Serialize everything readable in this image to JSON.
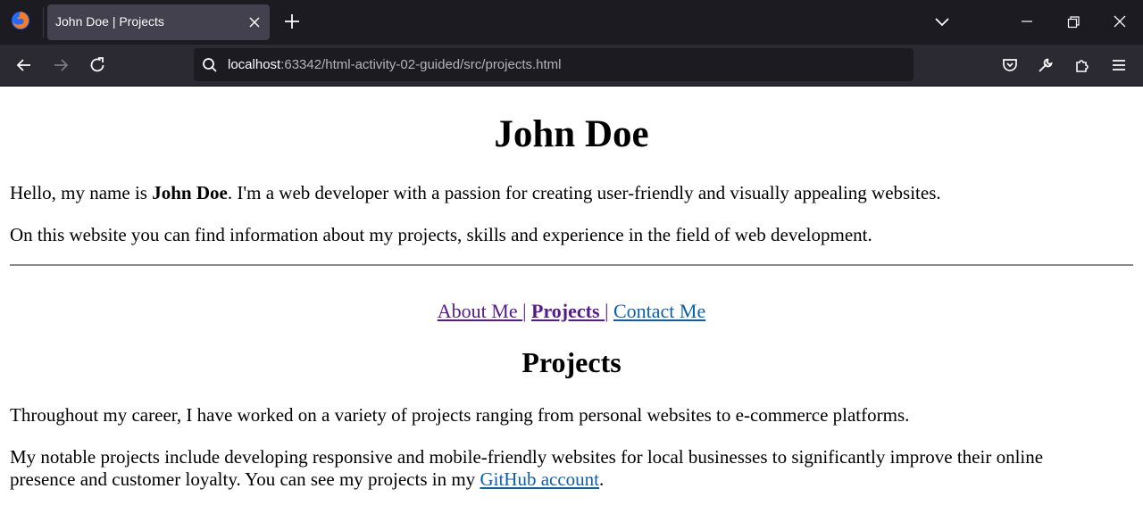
{
  "browser": {
    "tab_title": "John Doe | Projects",
    "url_host": "localhost",
    "url_path": ":63342/html-activity-02-guided/src/projects.html"
  },
  "page": {
    "heading": "John Doe",
    "intro": {
      "before": "Hello, my name is ",
      "name": "John Doe",
      "after": ". I'm a web developer with a passion for creating user-friendly and visually appealing websites."
    },
    "info": "On this website you can find information about my projects, skills and experience in the field of web development.",
    "nav": {
      "about": "About Me ",
      "sep1": "|",
      "projects": "Projects ",
      "sep2": "|",
      "contact": "Contact Me"
    },
    "section_heading": "Projects",
    "projects_intro": "Throughout my career, I have worked on a variety of projects ranging from personal websites to e-commerce platforms.",
    "notable": {
      "line1": "My notable projects include developing responsive and mobile-friendly websites for local businesses to significantly improve their online",
      "line2_before": "presence and customer loyalty. You can see my projects in my ",
      "link": "GitHub account",
      "line2_after": "."
    }
  },
  "icons": {
    "logo": "firefox-logo-icon",
    "tab_close": "close-icon",
    "new_tab": "plus-icon",
    "tab_list": "chevron-down-icon",
    "minimize": "minimize-icon",
    "restore": "restore-icon",
    "close_window": "close-icon",
    "back": "back-arrow-icon",
    "forward": "forward-arrow-icon",
    "reload": "reload-icon",
    "search": "search-icon",
    "pocket": "pocket-icon",
    "devtools": "wrench-icon",
    "extensions": "puzzle-icon",
    "menu": "hamburger-menu-icon"
  },
  "colors": {
    "visited_link": "#551a8b",
    "unvisited_link": "#0b5fb0",
    "chrome_dark": "#1c1b22",
    "toolbar": "#2b2a33"
  }
}
